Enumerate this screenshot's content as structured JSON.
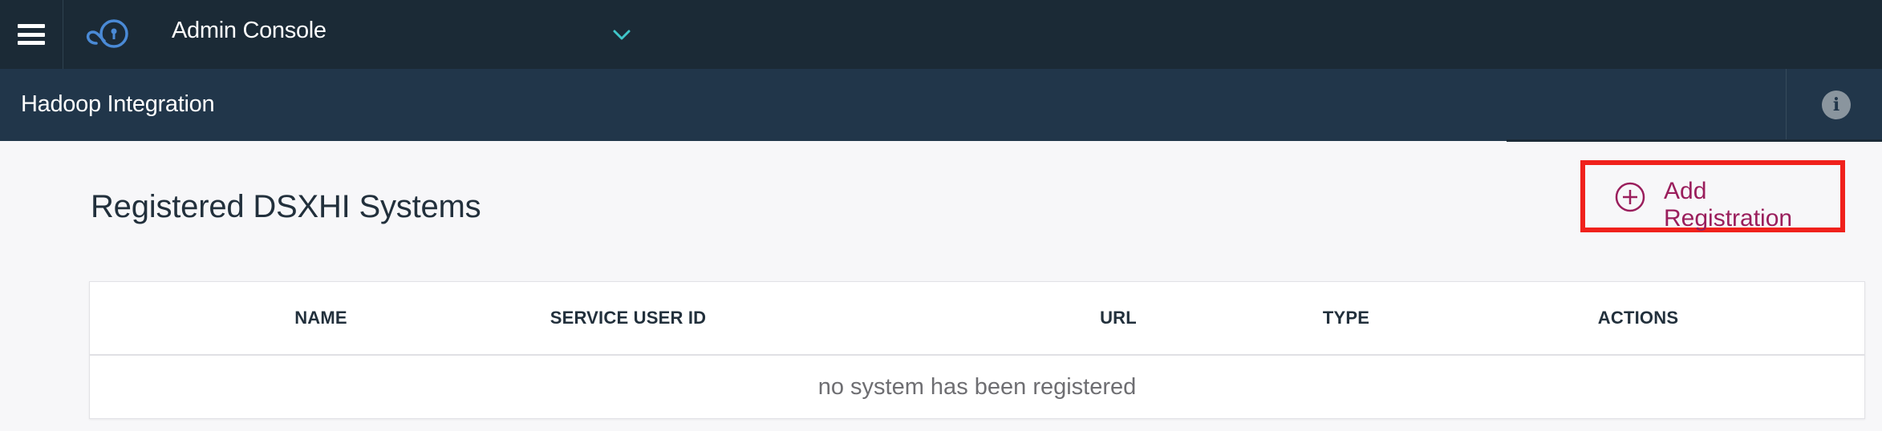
{
  "header": {
    "app_title": "Admin Console",
    "icons": {
      "menu": "hamburger-menu-icon",
      "logo": "cloud-key-logo-icon",
      "switcher": "chevron-down-icon"
    }
  },
  "subheader": {
    "page_title": "Hadoop Integration",
    "info_icon": "info-icon",
    "info_glyph": "i"
  },
  "main": {
    "section_title": "Registered DSXHI Systems",
    "add_button_label": "Add Registration",
    "add_icon": "plus-circle-icon"
  },
  "table": {
    "columns": [
      "NAME",
      "SERVICE USER ID",
      "URL",
      "TYPE",
      "ACTIONS"
    ],
    "empty_message": "no system has been registered"
  },
  "colors": {
    "topbar": "#1b2a36",
    "subheader": "#21364a",
    "accent_teal": "#3fc6c9",
    "accent_magenta": "#9a1e5c",
    "highlight_red": "#f0211c"
  }
}
